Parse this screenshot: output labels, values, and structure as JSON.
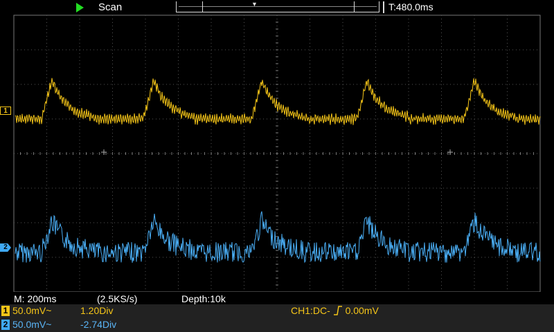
{
  "topbar": {
    "run_state": "running",
    "mode": "Scan",
    "trigger_time": "T:480.0ms",
    "colors": {
      "run": "#22dd22"
    }
  },
  "channels": [
    {
      "id": "1",
      "color": "#f5c518",
      "scale": "50.0mV~",
      "offset": "1.20Div"
    },
    {
      "id": "2",
      "color": "#3fa9f5",
      "scale": "50.0mV~",
      "offset": "-2.74Div"
    }
  ],
  "timebase": {
    "main": "M: 200ms",
    "sample_rate": "(2.5KS/s)",
    "depth": "Depth:10k"
  },
  "trigger": {
    "status": "CH1:DC-",
    "slope_icon": "rising-edge-icon",
    "level": "0.00mV"
  }
}
